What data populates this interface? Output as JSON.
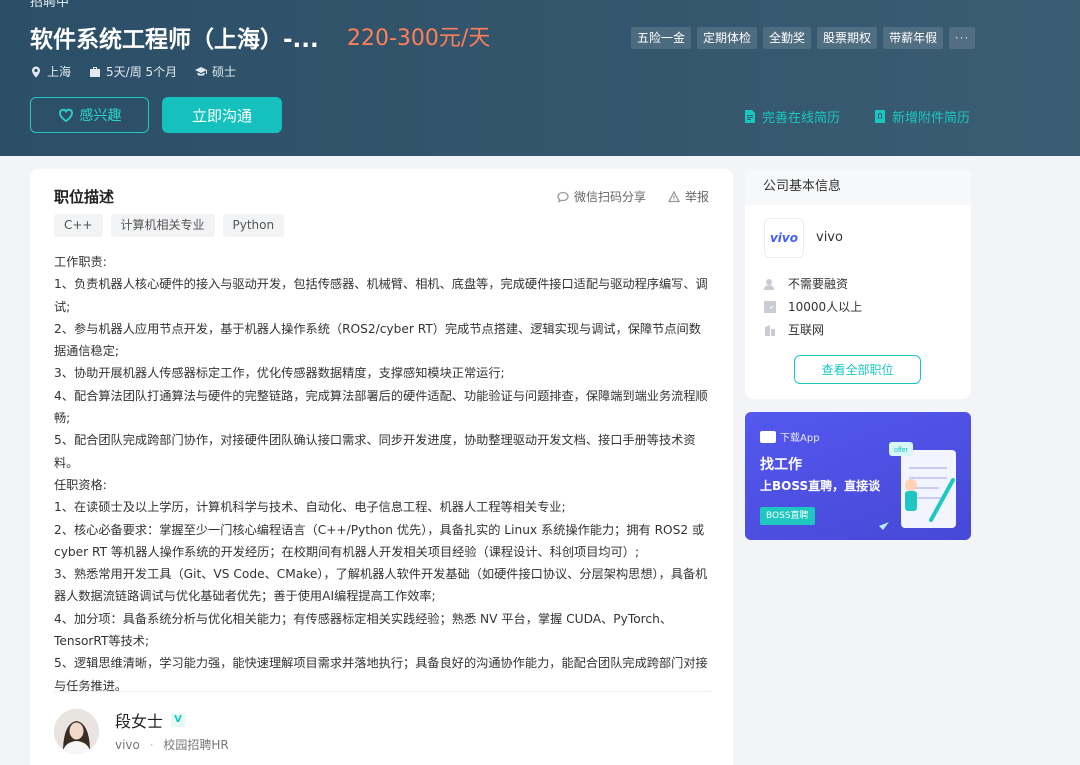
{
  "header": {
    "status": "招聘中",
    "job_title": "软件系统工程师（上海）-...",
    "salary": "220-300元/天",
    "meta": {
      "city": "上海",
      "schedule": "5天/周 5个月",
      "degree": "硕士"
    },
    "benefits": [
      "五险一金",
      "定期体检",
      "全勤奖",
      "股票期权",
      "带薪年假"
    ],
    "benefits_more": "···",
    "interest_button": "感兴趣",
    "chat_button": "立即沟通",
    "online_resume": "完善在线简历",
    "attachment_resume": "新增附件简历"
  },
  "job": {
    "section_title": "职位描述",
    "share_label": "微信扫码分享",
    "report_label": "举报",
    "skills": [
      "C++",
      "计算机相关专业",
      "Python"
    ],
    "description": [
      "工作职责:",
      "1、负责机器人核心硬件的接入与驱动开发，包括传感器、机械臂、相机、底盘等，完成硬件接口适配与驱动程序编写、调试;",
      "2、参与机器人应用节点开发，基于机器人操作系统（ROS2/cyber RT）完成节点搭建、逻辑实现与调试，保障节点间数据通信稳定;",
      "3、协助开展机器人传感器标定工作，优化传感器数据精度，支撑感知模块正常运行;",
      "4、配合算法团队打通算法与硬件的完整链路，完成算法部署后的硬件适配、功能验证与问题排查，保障端到端业务流程顺畅;",
      "5、配合团队完成跨部门协作，对接硬件团队确认接口需求、同步开发进度，协助整理驱动开发文档、接口手册等技术资料。",
      "任职资格:",
      "1、在读硕士及以上学历，计算机科学与技术、自动化、电子信息工程、机器人工程等相关专业;",
      "2、核心必备要求：掌握至少一门核心编程语言（C++/Python 优先），具备扎实的 Linux 系统操作能力；拥有 ROS2 或 cyber RT 等机器人操作系统的开发经历；在校期间有机器人开发相关项目经验（课程设计、科创项目均可）;",
      "3、熟悉常用开发工具（Git、VS Code、CMake），了解机器人软件开发基础（如硬件接口协议、分层架构思想），具备机器人数据流链路调试与优化基础者优先；善于使用AI编程提高工作效率;",
      "4、加分项：具备系统分析与优化相关能力；有传感器标定相关实践经验；熟悉 NV 平台，掌握 CUDA、PyTorch、TensorRT等技术;",
      "5、逻辑思维清晰，学习能力强，能快速理解项目需求并落地执行；具备良好的沟通协作能力，能配合团队完成跨部门对接与任务推进。"
    ]
  },
  "recruiter": {
    "name": "段女士",
    "verify": "V",
    "company": "vivo",
    "separator": "·",
    "role": "校园招聘HR"
  },
  "company": {
    "section_title": "公司基本信息",
    "logo_text": "vivo",
    "name": "vivo",
    "funding": "不需要融资",
    "size": "10000人以上",
    "industry": "互联网",
    "all_jobs_button": "查看全部职位"
  },
  "banner": {
    "download": "下载App",
    "title": "找工作",
    "subtitle": "上BOSS直聘，直接谈",
    "badge": "BOSS直聘",
    "art_text": "offer"
  },
  "colors": {
    "header_bg": "#34566d",
    "accent": "#19c7c0",
    "salary": "#ff7f5a",
    "banner_bg": "#4d50e2"
  }
}
